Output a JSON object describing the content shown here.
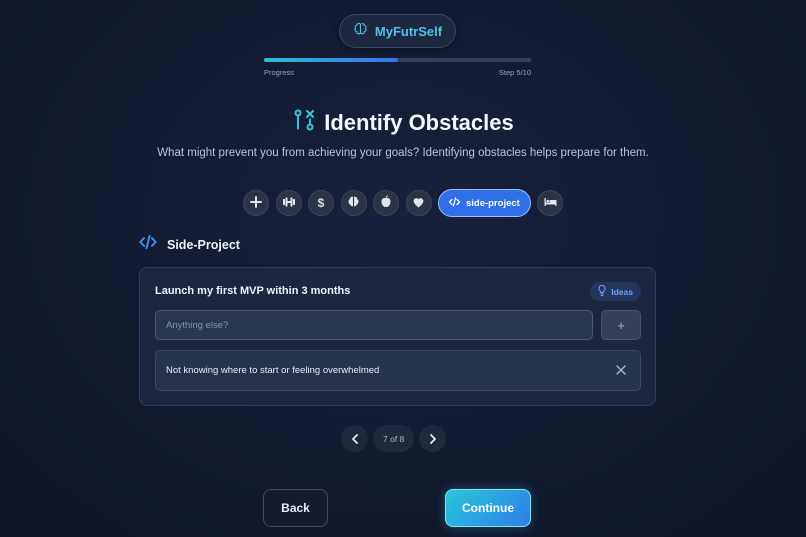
{
  "brand": {
    "name": "MyFutrSelf",
    "icon": "brain-icon",
    "color": "#4cc3e6"
  },
  "progress": {
    "label": "Progress",
    "step_text": "Step 5/10",
    "fraction": 0.5
  },
  "page": {
    "title": "Identify Obstacles",
    "title_icon": "route-obstacle-icon",
    "subtitle": "What might prevent you from achieving your goals? Identifying obstacles helps prepare for them."
  },
  "categories": {
    "icons": [
      "plus-icon",
      "dumbbell-icon",
      "dollar-icon",
      "brain-icon",
      "apple-icon",
      "heart-icon"
    ],
    "active_label": "side-project",
    "active_icon": "code-icon",
    "trailing_icon": "bed-icon"
  },
  "section": {
    "label": "Side-Project",
    "icon": "code-icon"
  },
  "card": {
    "goal": "Launch my first MVP within 3 months",
    "ideas_label": "Ideas",
    "input_placeholder": "Anything else?",
    "add_symbol": "+",
    "obstacles": [
      "Not knowing where to start or feeling overwhelmed"
    ]
  },
  "pager": {
    "text": "7 of 8"
  },
  "actions": {
    "back": "Back",
    "continue": "Continue"
  },
  "colors": {
    "accent": "#2f6fe8",
    "teal": "#27c7d9"
  }
}
